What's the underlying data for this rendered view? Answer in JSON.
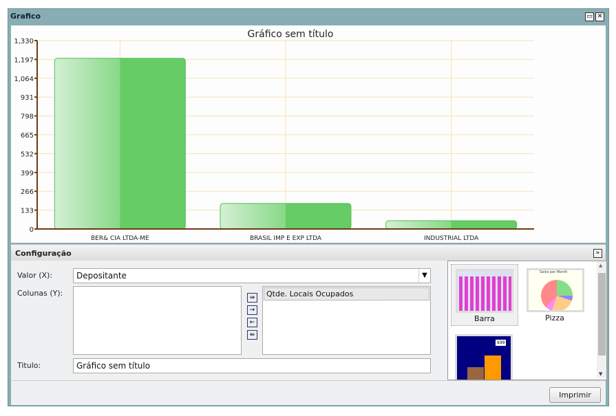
{
  "window": {
    "title": "Grafico"
  },
  "chart_data": {
    "type": "bar",
    "title": "Gráfico sem título",
    "categories": [
      "BER& CIA LTDA-ME",
      "BRASIL IMP E EXP LTDA",
      "INDUSTRIAL LTDA"
    ],
    "values": [
      1205,
      180,
      58
    ],
    "ylim": [
      0,
      1330
    ],
    "yticks": [
      "0",
      "133",
      "266",
      "399",
      "532",
      "665",
      "798",
      "931",
      "1,064",
      "1,197",
      "1,330"
    ],
    "xlabel": "",
    "ylabel": "",
    "bar_color": "#66cc66"
  },
  "config": {
    "title": "Configuração",
    "valor_label": "Valor (X):",
    "valor_value": "Depositante",
    "colunas_label": "Colunas (Y):",
    "selected_columns": [
      "Qtde. Locais Ocupados"
    ],
    "titulo_label": "Titulo:",
    "titulo_value": "Gráfico sem título",
    "types": [
      "Barra",
      "Pizza"
    ],
    "pie_thumb_title": "Sales per Month",
    "price_tag": "$99"
  },
  "footer": {
    "print_label": "Imprimir"
  }
}
